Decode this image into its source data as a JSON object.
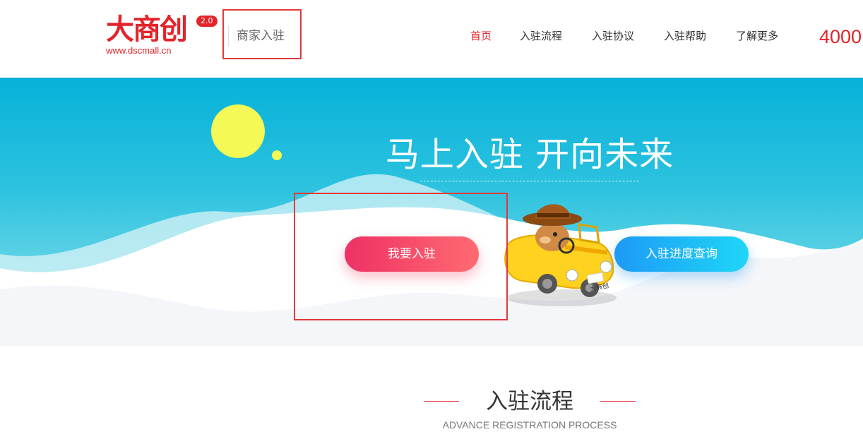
{
  "header": {
    "logo_text": "大商创",
    "logo_version": "2.0",
    "logo_url": "www.dscmall.cn",
    "site_title": "商家入驻",
    "phone": "4000"
  },
  "nav": {
    "items": [
      {
        "label": "首页",
        "active": true
      },
      {
        "label": "入驻流程",
        "active": false
      },
      {
        "label": "入驻协议",
        "active": false
      },
      {
        "label": "入驻帮助",
        "active": false
      },
      {
        "label": "了解更多",
        "active": false
      }
    ]
  },
  "banner": {
    "slogan": "马上入驻 开向未来",
    "join_button": "我要入驻",
    "progress_button": "入驻进度查询",
    "mascot_car_label": "大商创"
  },
  "section": {
    "title": "入驻流程",
    "subtitle": "ADVANCE REGISTRATION PROCESS"
  },
  "colors": {
    "brand_red": "#e3242b",
    "sky_blue": "#07b1d9",
    "join_gradient": [
      "#ee3165",
      "#ff6a71"
    ],
    "progress_gradient": [
      "#1d9af5",
      "#1fd6f7"
    ],
    "sun": "#f5f955"
  }
}
